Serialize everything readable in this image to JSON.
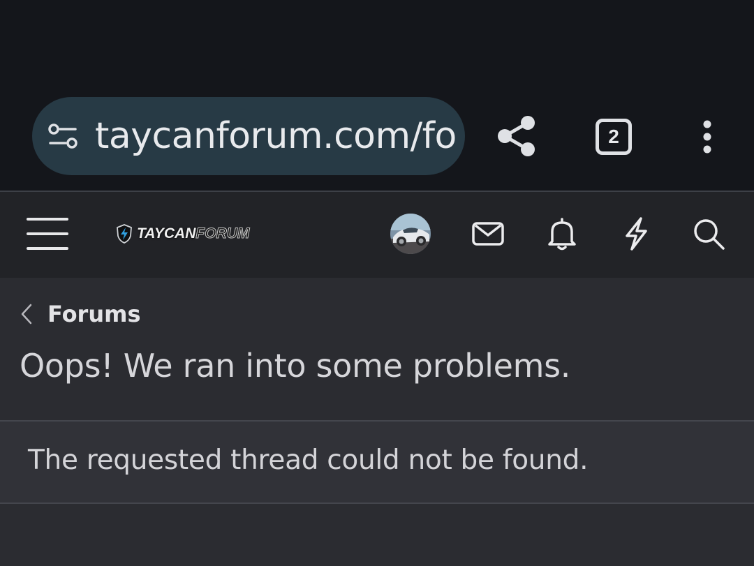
{
  "browser": {
    "url": "taycanforum.com/fo",
    "tab_count": "2",
    "icons": [
      "site-settings-icon",
      "share-icon",
      "tabs-icon",
      "more-vert-icon"
    ]
  },
  "header": {
    "logo_part1": "TAYCAN",
    "logo_part2": "FORUM",
    "icons": [
      "menu-icon",
      "avatar",
      "mail-icon",
      "bell-icon",
      "bolt-icon",
      "search-icon"
    ]
  },
  "breadcrumb": {
    "label": "Forums"
  },
  "page": {
    "title": "Oops! We ran into some problems.",
    "message": "The requested thread could not be found."
  },
  "colors": {
    "browser_bg": "#14161b",
    "url_pill": "#273a45",
    "header_bg": "#222327",
    "content_bg": "#2b2c31",
    "message_bg": "#313238"
  }
}
